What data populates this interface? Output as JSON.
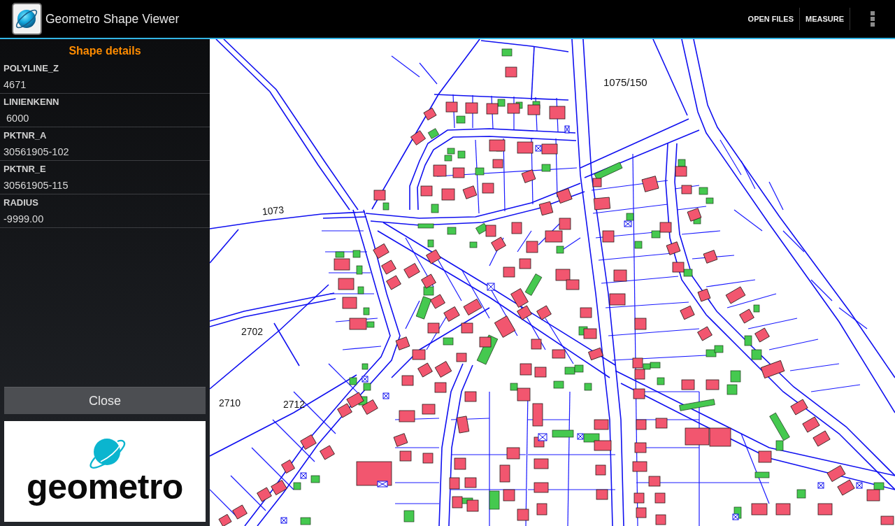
{
  "app_bar": {
    "title": "Geometro Shape Viewer",
    "actions": [
      {
        "label": "OPEN FILES"
      },
      {
        "label": "MEASURE"
      }
    ]
  },
  "details_panel": {
    "title": "Shape details",
    "fields": [
      {
        "label": "POLYLINE_Z",
        "value": "4671"
      },
      {
        "label": "LINIENKENN",
        "value": " 6000"
      },
      {
        "label": "PKTNR_A",
        "value": "30561905-102"
      },
      {
        "label": "PKTNR_E",
        "value": "30561905-115"
      },
      {
        "label": "RADIUS",
        "value": "-9999.00"
      }
    ],
    "close_button": {
      "label": "Close"
    },
    "logo": {
      "wordmark": "geometro"
    }
  },
  "map": {
    "labels": [
      "1075/150",
      "1073",
      "2702",
      "2710",
      "2712"
    ]
  }
}
